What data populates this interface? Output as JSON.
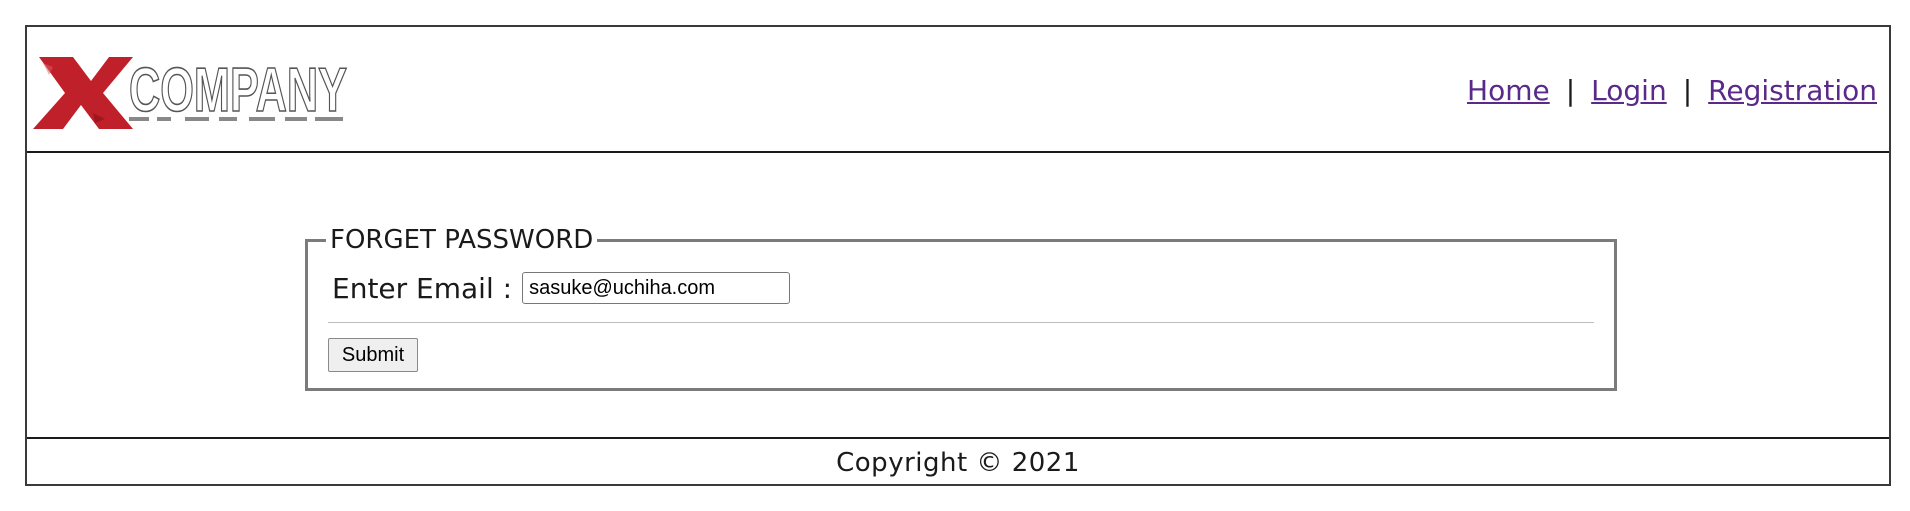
{
  "header": {
    "logo": {
      "mark": "X",
      "text": "COMPANY",
      "mark_color": "#c0202a"
    },
    "nav": {
      "items": [
        {
          "label": "Home"
        },
        {
          "label": "Login"
        },
        {
          "label": "Registration"
        }
      ],
      "separator": "|",
      "link_color": "#5a2a8a"
    }
  },
  "form": {
    "legend": "FORGET PASSWORD",
    "email_label": "Enter Email :",
    "email_value": "sasuke@uchiha.com",
    "submit_label": "Submit"
  },
  "footer": {
    "copyright": "Copyright © 2021"
  }
}
